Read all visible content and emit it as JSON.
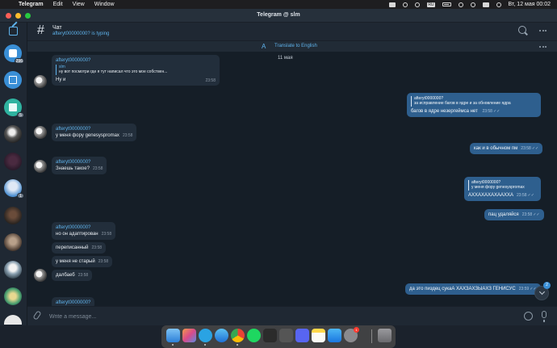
{
  "menubar": {
    "app": "Telegram",
    "items": [
      "Edit",
      "View",
      "Window"
    ],
    "datetime": "Вт, 12 мая  00:02",
    "keyboard": "RU"
  },
  "window": {
    "title": "Telegram @ slm"
  },
  "sidebar": {
    "badges": {
      "chat1": "296",
      "chat3": "5",
      "chat6": "1"
    }
  },
  "header": {
    "title": "Чат",
    "typing": "afteryt00000000? is typing"
  },
  "translate": {
    "label": "Translate to English"
  },
  "messages": {
    "date": "11 мая",
    "m1": {
      "sender": "afteryt0000000?",
      "quote_name": "slm",
      "quote_text": "ну вот посмотри где я тут написал что это мое собствен...",
      "text": "Ну и",
      "time": "23:58"
    },
    "m2": {
      "quote_name": "afteryt0000000?",
      "quote_text": "за исправление багов в ядре и за обновление ядра",
      "text": "багов в ядре незергеймса нет",
      "time": "23:58"
    },
    "m3": {
      "sender": "afteryt0000000?",
      "text": "у меня фору genesyspromax",
      "time": "23:58"
    },
    "m4": {
      "text": "как и в обычном пм",
      "time": "23:58"
    },
    "m5": {
      "sender": "afteryt0000000?",
      "text": "Знаешь такое?",
      "time": "23:58"
    },
    "m6": {
      "quote_name": "afteryt0000000?",
      "quote_text": "у меня фору genesyspromax",
      "text": "АХХАХАХАХААХХА",
      "time": "23:58"
    },
    "m7": {
      "text": "пац удаляйся",
      "time": "23:58"
    },
    "m8": {
      "sender": "afteryt0000000?",
      "text": "но он адаптирован",
      "time": "23:58"
    },
    "m9": {
      "text": "переписанный",
      "time": "23:58"
    },
    "m10": {
      "text": "у меня не старый",
      "time": "23:58"
    },
    "m11": {
      "text": "далбаеб",
      "time": "23:58"
    },
    "m12": {
      "text": "да это пиздец сукаА ХАХЗАХЗЫАХЗ ГЕНИСУС",
      "time": "23:59"
    },
    "m13": {
      "sender": "afteryt0000000?"
    },
    "unread_badge": "2"
  },
  "composer": {
    "placeholder": "Write a message..."
  },
  "colors": {
    "accent": "#5fb3ec",
    "outgoing_bubble": "#2e5f8e",
    "incoming_bubble": "#222e3b",
    "chat_background": "#151e27"
  }
}
